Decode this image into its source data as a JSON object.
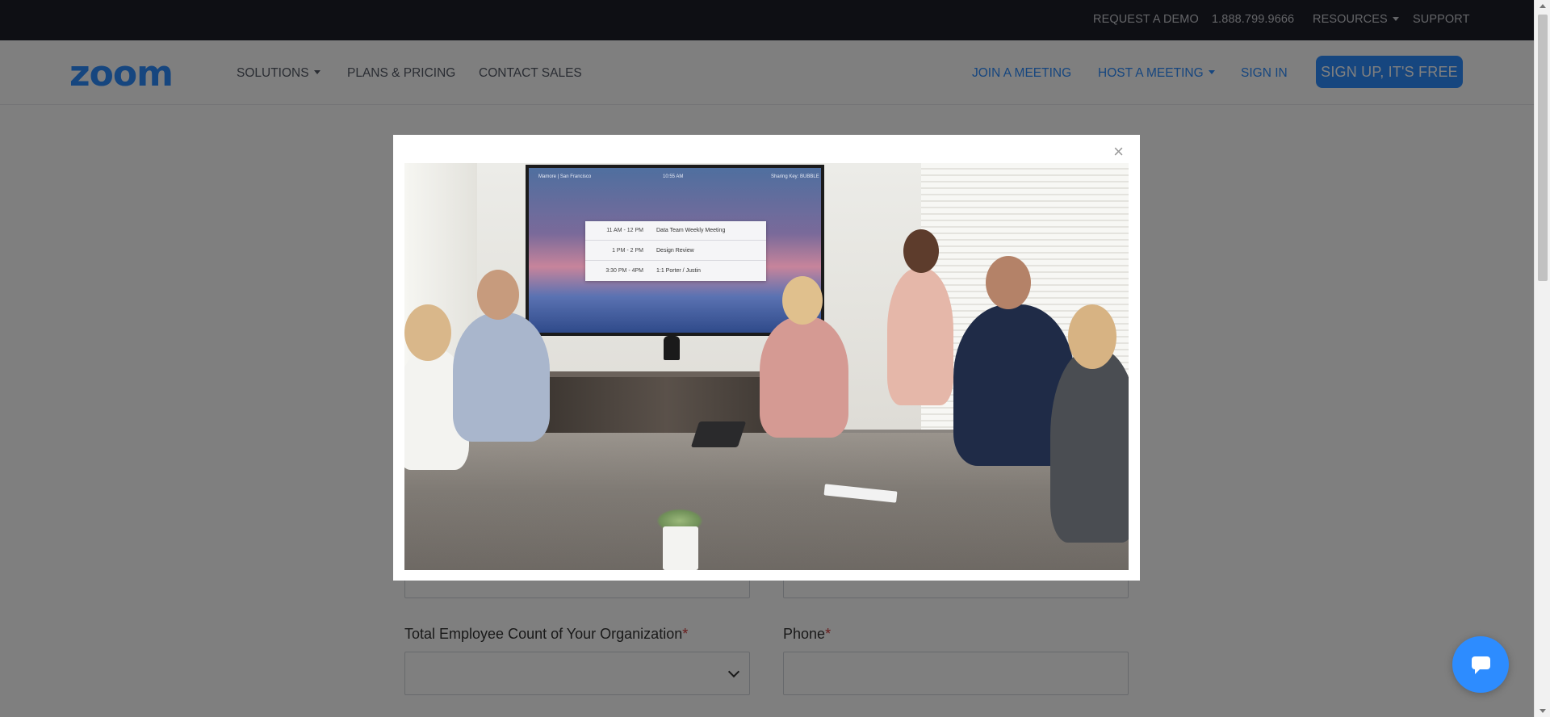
{
  "utility_bar": {
    "request_demo": "REQUEST A DEMO",
    "phone": "1.888.799.9666",
    "resources": "RESOURCES",
    "support": "SUPPORT"
  },
  "main_nav": {
    "logo": "zoom",
    "solutions": "SOLUTIONS",
    "plans_pricing": "PLANS & PRICING",
    "contact_sales": "CONTACT SALES",
    "join_meeting": "JOIN A MEETING",
    "host_meeting": "HOST A MEETING",
    "sign_in": "SIGN IN",
    "signup_button": "SIGN UP, IT'S FREE"
  },
  "form": {
    "employee_count_label": "Total Employee Count of Your Organization",
    "employee_count_value": "",
    "phone_label": "Phone",
    "phone_value": "",
    "required_marker": "*"
  },
  "modal": {
    "close_symbol": "×",
    "video": {
      "tv_location": "Mamore | San Francisco",
      "tv_time": "10:55 AM",
      "tv_sharing_key": "Sharing Key: BUBBLE",
      "schedule": [
        {
          "time": "11 AM - 12 PM",
          "title": "Data Team Weekly Meeting"
        },
        {
          "time": "1 PM - 2 PM",
          "title": "Design Review"
        },
        {
          "time": "3:30 PM - 4PM",
          "title": "1:1 Porter / Justin"
        }
      ]
    }
  },
  "colors": {
    "brand_blue": "#2d8cff",
    "utility_bar_bg": "#1c1e29",
    "overlay": "rgba(0,0,0,0.5)",
    "required": "#d23b3b"
  },
  "icons": {
    "close": "close-icon",
    "chat": "chat-icon",
    "dropdown": "chevron-down-icon"
  }
}
